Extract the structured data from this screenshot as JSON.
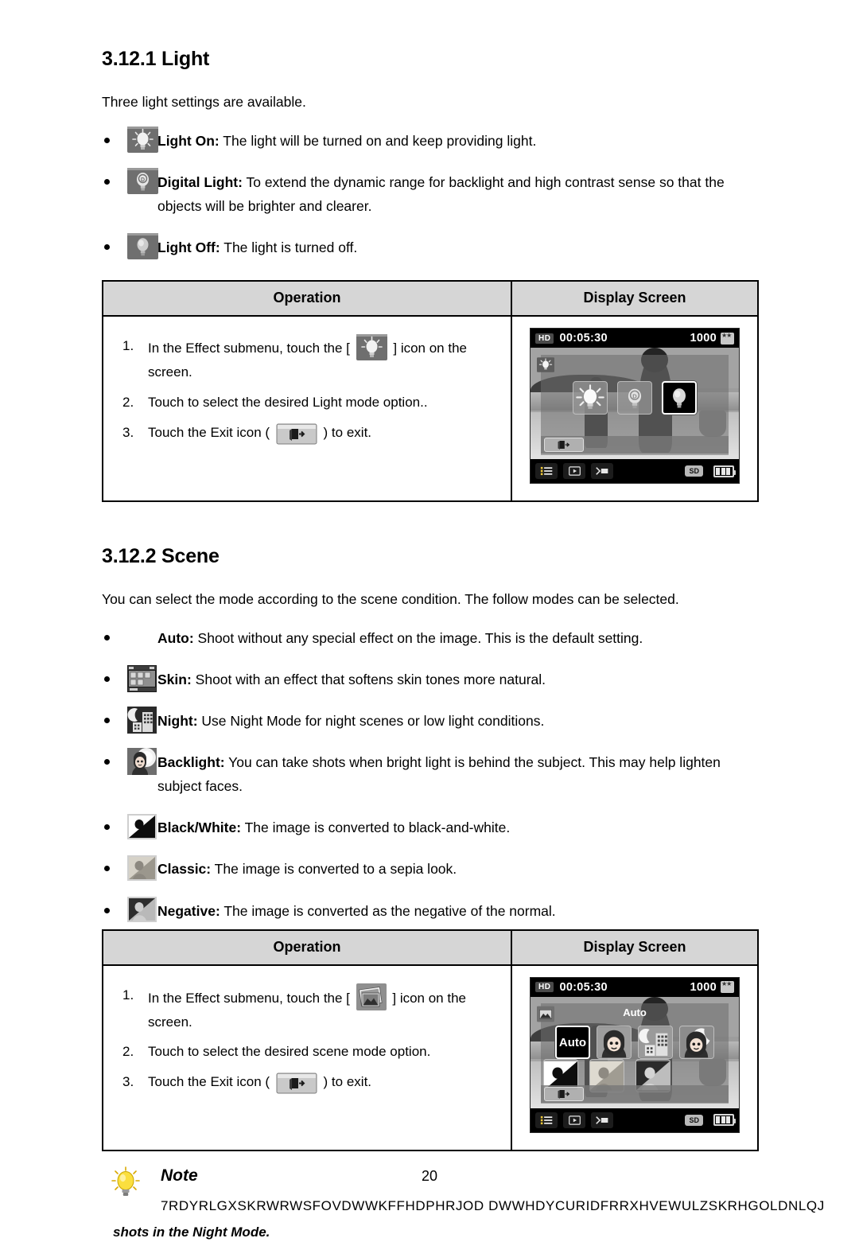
{
  "document": {
    "page_number": "20"
  },
  "light_section": {
    "heading": "3.12.1 Light",
    "intro": "Three light settings are available.",
    "items": [
      {
        "icon": "light-on-icon",
        "label": "Light On:",
        "text": " The light will be turned on and keep providing light."
      },
      {
        "icon": "digital-light-icon",
        "label": "Digital Light:",
        "text": " To extend the dynamic range for backlight and high contrast sense so that the objects will be brighter and clearer."
      },
      {
        "icon": "light-off-icon",
        "label": "Light Off:",
        "text": " The light is turned off."
      }
    ],
    "table": {
      "headers": {
        "operation": "Operation",
        "display": "Display Screen"
      },
      "steps": {
        "step1_a": "In the Effect submenu, touch the [",
        "step1_b": "] icon on the screen.",
        "step2": "Touch to select the desired Light mode option..",
        "step3_a": "Touch the Exit icon (",
        "step3_b": ") to exit."
      },
      "screen": {
        "hd_badge": "HD",
        "time": "00:05:30",
        "count": "1000",
        "sd_badge": "SD",
        "options": [
          "light-on-icon",
          "digital-light-icon",
          "light-off-icon"
        ],
        "selected_index": 2
      }
    }
  },
  "scene_section": {
    "heading": "3.12.2 Scene",
    "intro": "You can select the mode according to the scene condition. The follow modes can be selected.",
    "items": [
      {
        "icon": "",
        "label": "Auto:",
        "text": " Shoot without any special effect on the image.  This is the default setting."
      },
      {
        "icon": "skin-icon",
        "label": "Skin:",
        "text": " Shoot with an effect that softens skin tones more natural."
      },
      {
        "icon": "night-icon",
        "label": "Night:",
        "text": " Use Night Mode for night scenes or low light conditions."
      },
      {
        "icon": "backlight-icon",
        "label": "Backlight:",
        "text": " You can take shots when bright light is behind the subject.  This may help lighten subject faces."
      },
      {
        "icon": "black-white-icon",
        "label": "Black/White:",
        "text": " The image is converted to black-and-white."
      },
      {
        "icon": "classic-icon",
        "label": "Classic:",
        "text": " The image is converted to a sepia look."
      },
      {
        "icon": "negative-icon",
        "label": "Negative:",
        "text": " The image is converted as the negative of the normal."
      }
    ],
    "table": {
      "headers": {
        "operation": "Operation",
        "display": "Display Screen"
      },
      "steps": {
        "step1_a": "In the  Effect submenu, touch the [",
        "step1_b": "] icon on the screen.",
        "step2": "Touch to select the desired scene mode option.",
        "step3_a": "Touch the Exit icon (",
        "step3_b": ") to exit."
      },
      "screen": {
        "hd_badge": "HD",
        "time": "00:05:30",
        "count": "1000",
        "mode_label": "Auto",
        "sd_badge": "SD",
        "auto_option": "Auto",
        "options_row1": [
          "auto-option",
          "skin-icon",
          "night-icon",
          "backlight-icon"
        ],
        "options_row2": [
          "black-white-icon",
          "classic-icon",
          "negative-icon"
        ],
        "selected_index": 0
      }
    }
  },
  "note": {
    "title": "Note",
    "line1": "7RDYRLGXSKRWRWSFOVDWWKFFHDPHRJOD DWWHDYCURIDFRRXHVEWULZSKRHGOLDNLQJ",
    "line2": "shots in the Night Mode."
  }
}
